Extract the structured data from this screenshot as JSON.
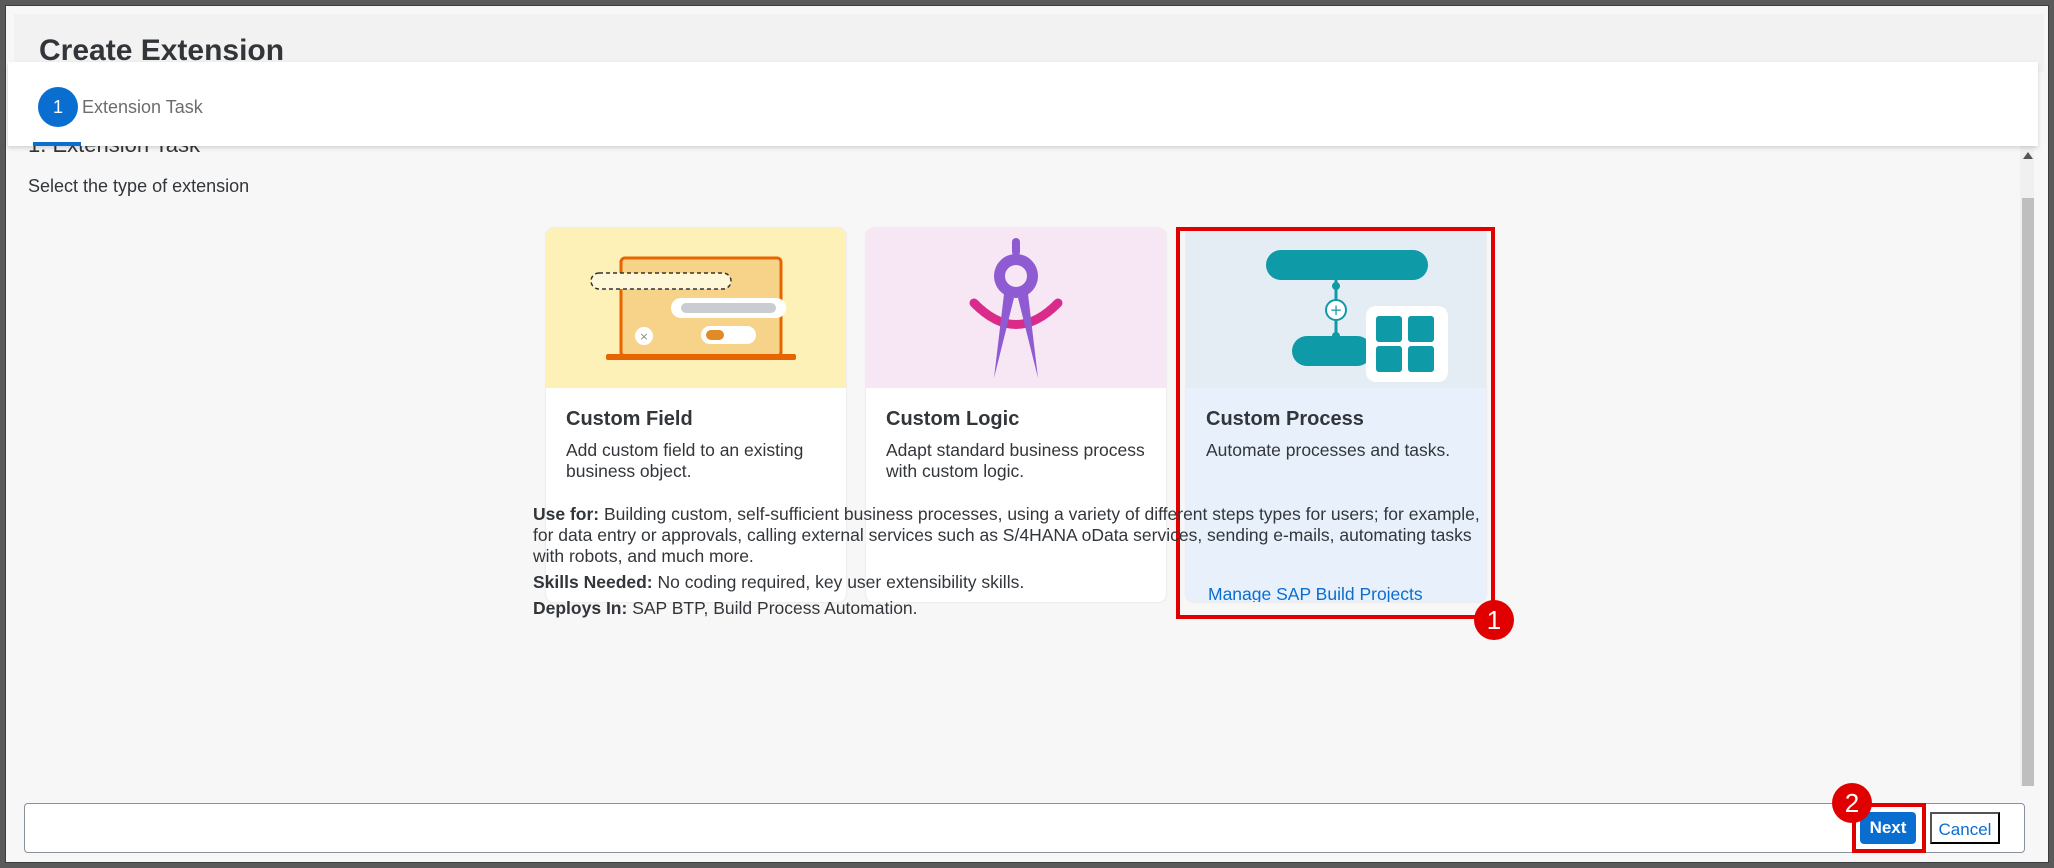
{
  "dialog": {
    "title": "Create Extension"
  },
  "wizard": {
    "step_number": "1",
    "step_label": "Extension Task"
  },
  "content": {
    "section_heading": "1. Extension Task",
    "instruction": "Select the type of extension"
  },
  "tiles": [
    {
      "title": "Custom Field",
      "description": "Add custom field to an existing business object.",
      "illustration": "laptop-form-illustration"
    },
    {
      "title": "Custom Logic",
      "description": "Adapt standard business process with custom logic.",
      "illustration": "drawing-compass-illustration"
    },
    {
      "title": "Custom Process",
      "description": "Automate processes and tasks.",
      "link": "Manage SAP Build Projects",
      "illustration": "process-flow-illustration",
      "selected": true
    }
  ],
  "info": {
    "use_for_label": "Use for:",
    "use_for_text": " Building custom, self-sufficient business processes, using a variety of different steps types for users; for example, for data entry or approvals, calling external services such as S/4HANA oData services, sending e-mails, automating tasks with robots, and much more.",
    "skills_label": "Skills Needed:",
    "skills_text": " No coding required, key user extensibility skills.",
    "deploys_label": "Deploys In:",
    "deploys_text": " SAP BTP, Build Process Automation."
  },
  "annotations": {
    "marker_1": "1",
    "marker_2": "2",
    "color": "#e00000"
  },
  "footer": {
    "next_label": "Next",
    "cancel_label": "Cancel"
  },
  "colors": {
    "accent": "#0a6ed1",
    "teal": "#0f9aa7",
    "purple": "#8f5bd2",
    "orange": "#e76500"
  }
}
